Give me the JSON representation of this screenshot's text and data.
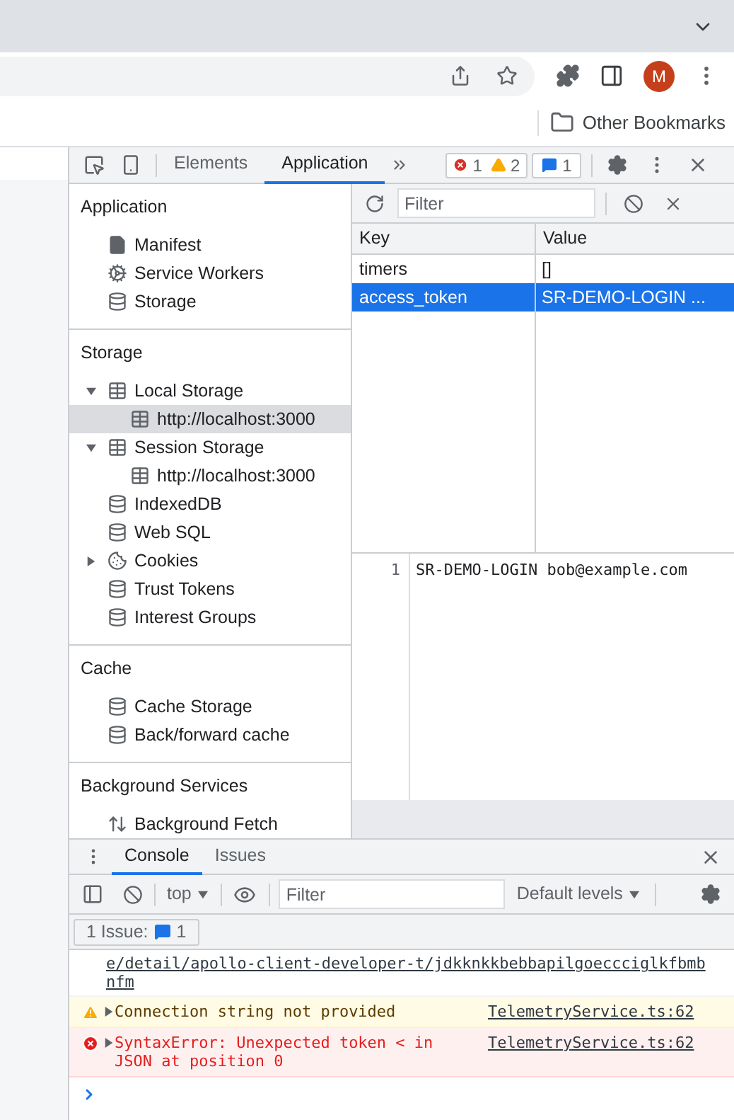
{
  "browser": {
    "profile_initial": "M",
    "bookmarks": [
      {
        "label": "Other Bookmarks"
      }
    ]
  },
  "devtools": {
    "tabs": [
      {
        "label": "Elements",
        "selected": false
      },
      {
        "label": "Application",
        "selected": true
      }
    ],
    "error_count": "1",
    "warning_count": "2",
    "message_count": "1"
  },
  "sidebar": {
    "sections": [
      {
        "title": "Application",
        "items": [
          {
            "label": "Manifest",
            "kind": "file",
            "selected": false
          },
          {
            "label": "Service Workers",
            "kind": "gear",
            "selected": false
          },
          {
            "label": "Storage",
            "kind": "database",
            "selected": false
          }
        ]
      },
      {
        "title": "Storage",
        "items": [
          {
            "label": "Local Storage",
            "kind": "grid",
            "selected": false,
            "expanded": true,
            "children": [
              {
                "label": "http://localhost:3000",
                "kind": "grid",
                "selected": true
              }
            ]
          },
          {
            "label": "Session Storage",
            "kind": "grid",
            "selected": false,
            "expanded": true,
            "children": [
              {
                "label": "http://localhost:3000",
                "kind": "grid",
                "selected": false
              }
            ]
          },
          {
            "label": "IndexedDB",
            "kind": "database",
            "selected": false
          },
          {
            "label": "Web SQL",
            "kind": "database",
            "selected": false
          },
          {
            "label": "Cookies",
            "kind": "cookie",
            "selected": false,
            "expanded": false
          },
          {
            "label": "Trust Tokens",
            "kind": "database",
            "selected": false
          },
          {
            "label": "Interest Groups",
            "kind": "database",
            "selected": false
          }
        ]
      },
      {
        "title": "Cache",
        "items": [
          {
            "label": "Cache Storage",
            "kind": "database",
            "selected": false
          },
          {
            "label": "Back/forward cache",
            "kind": "database",
            "selected": false
          }
        ]
      },
      {
        "title": "Background Services",
        "items": [
          {
            "label": "Background Fetch",
            "kind": "updown",
            "selected": false
          }
        ]
      }
    ]
  },
  "storage_table": {
    "filter": {
      "placeholder": "Filter"
    },
    "columns": [
      "Key",
      "Value"
    ],
    "rows": [
      {
        "key": "timers",
        "value": "[]",
        "selected": false
      },
      {
        "key": "access_token",
        "value": "SR-DEMO-LOGIN ...",
        "selected": true
      }
    ]
  },
  "preview": {
    "line_number": "1",
    "text": "SR-DEMO-LOGIN bob@example.com"
  },
  "drawer": {
    "tabs": [
      {
        "label": "Console",
        "selected": true
      },
      {
        "label": "Issues",
        "selected": false
      }
    ],
    "context": "top",
    "filter": {
      "placeholder": "Filter"
    },
    "levels": "Default levels",
    "issues_button": {
      "label": "1 Issue:",
      "count": "1"
    },
    "messages": [
      {
        "kind": "link",
        "lines": [
          "e/detail/apollo-client-developer-t/jdkknkkbebbapilgoeccciglkfbmb",
          "nfm"
        ]
      },
      {
        "kind": "warning",
        "text": "Connection string not provided",
        "source": "TelemetryService.ts:62"
      },
      {
        "kind": "error",
        "text": "SyntaxError: Unexpected token < in JSON at position 0",
        "source": "TelemetryService.ts:62"
      }
    ]
  }
}
